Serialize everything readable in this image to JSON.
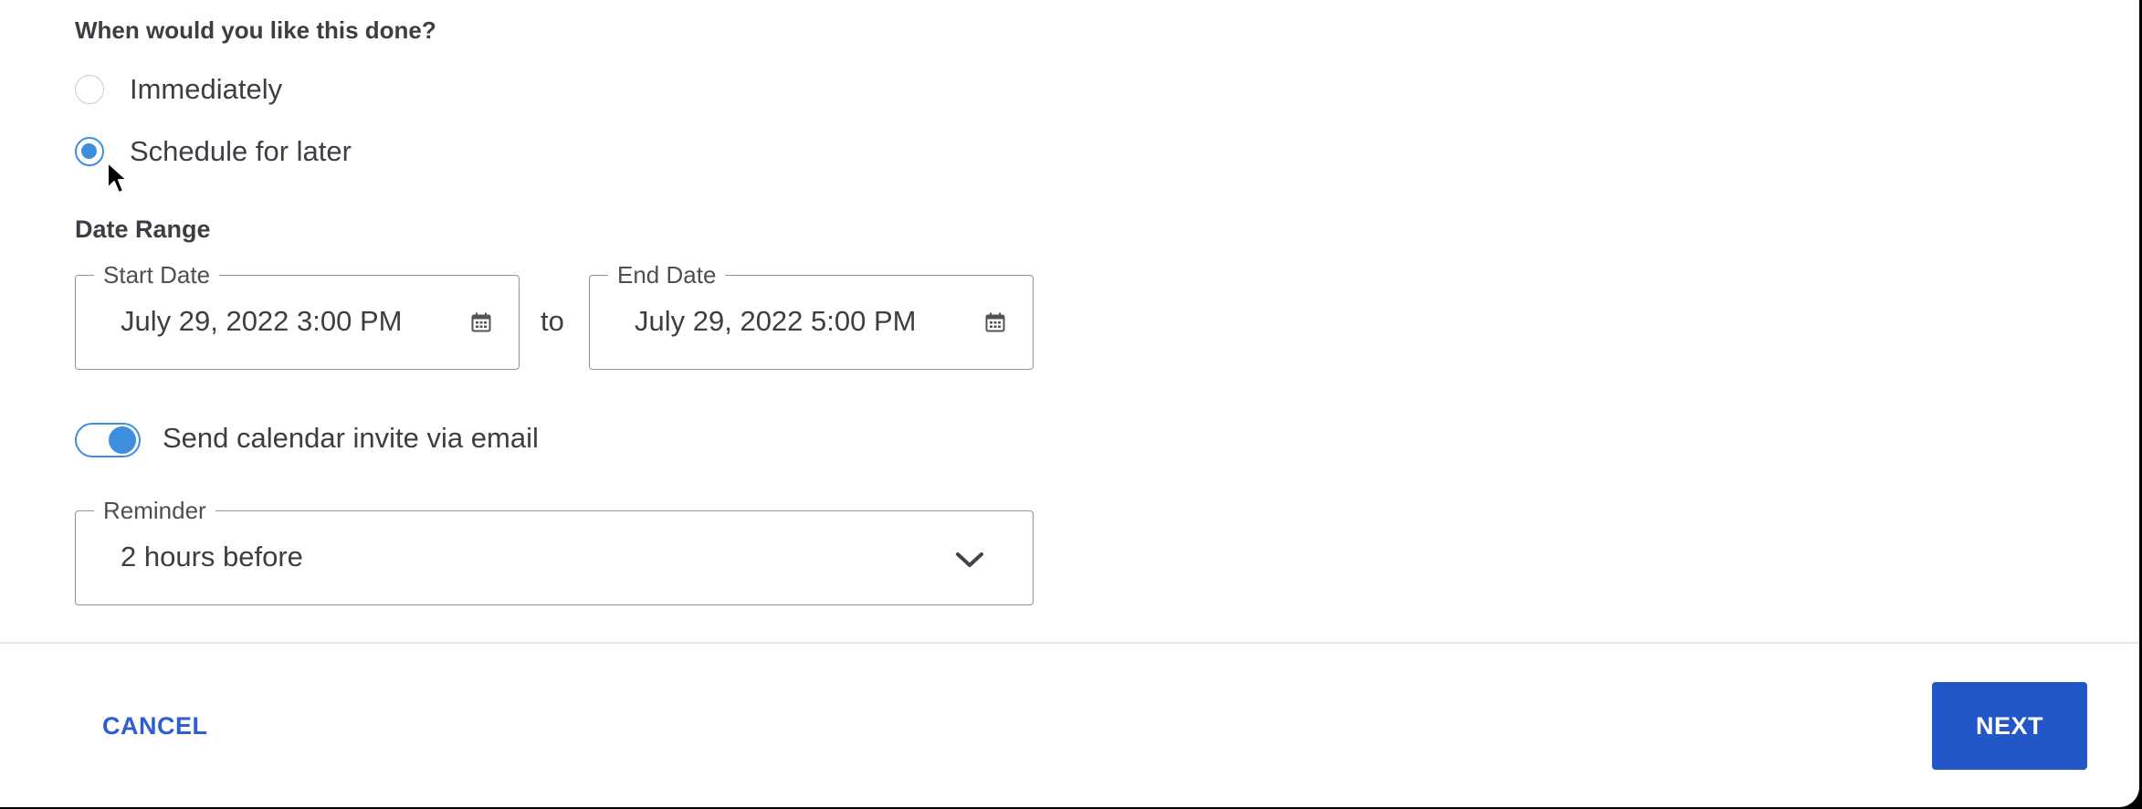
{
  "question": "When would you like this done?",
  "timing_options": [
    {
      "label": "Immediately",
      "selected": false
    },
    {
      "label": "Schedule for later",
      "selected": true
    }
  ],
  "date_range": {
    "label": "Date Range",
    "start": {
      "label": "Start Date",
      "value": "July 29, 2022 3:00 PM",
      "icon": "calendar-icon"
    },
    "separator": "to",
    "end": {
      "label": "End Date",
      "value": "July 29, 2022 5:00 PM",
      "icon": "calendar-icon"
    }
  },
  "calendar_invite": {
    "label": "Send calendar invite via email",
    "enabled": true
  },
  "reminder": {
    "label": "Reminder",
    "value": "2 hours before",
    "icon": "chevron-down-icon"
  },
  "footer": {
    "cancel_label": "CANCEL",
    "next_label": "NEXT"
  },
  "colors": {
    "accent": "#3d8fde",
    "primary_button": "#2356c7",
    "link": "#2d5fd1",
    "border": "#8e949a"
  }
}
